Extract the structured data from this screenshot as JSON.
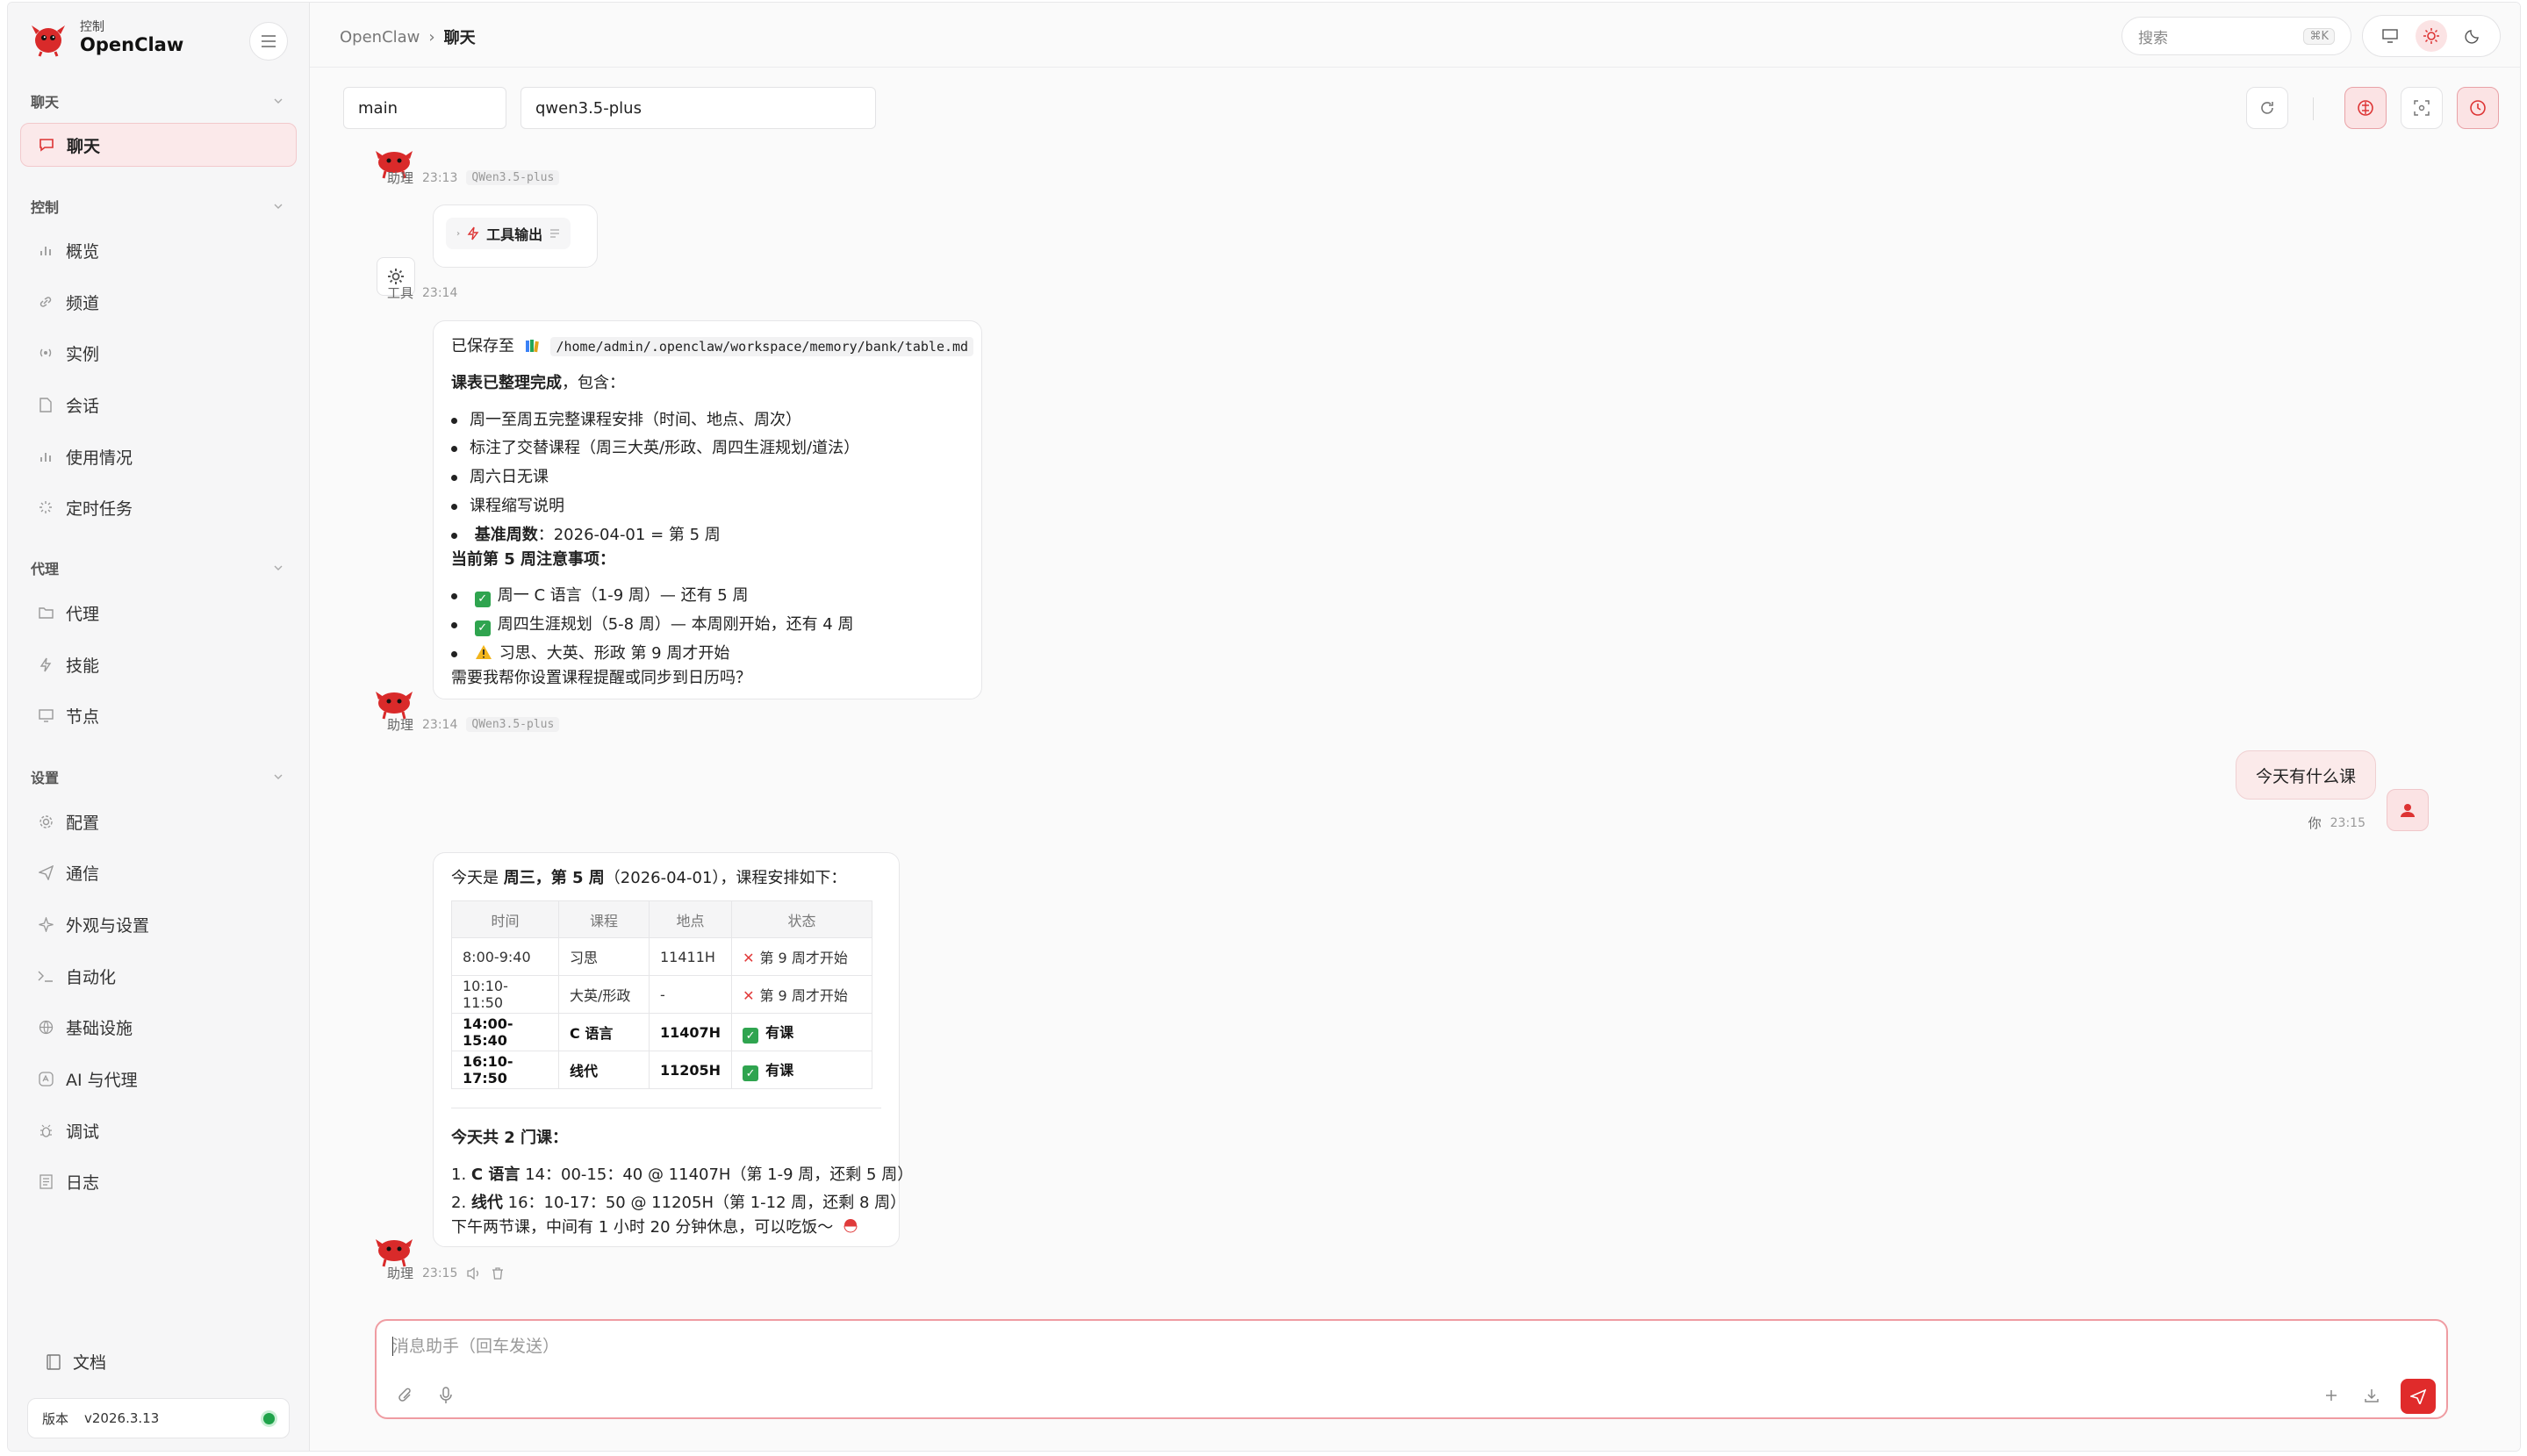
{
  "brand": {
    "sub": "控制",
    "name": "OpenClaw"
  },
  "sidebar": {
    "groups": [
      {
        "title": "聊天",
        "items": [
          {
            "label": "聊天",
            "icon": "chat-icon"
          }
        ]
      },
      {
        "title": "控制",
        "items": [
          {
            "label": "概览",
            "icon": "bar-chart-icon"
          },
          {
            "label": "频道",
            "icon": "link-icon"
          },
          {
            "label": "实例",
            "icon": "radio-icon"
          },
          {
            "label": "会话",
            "icon": "file-icon"
          },
          {
            "label": "使用情况",
            "icon": "bar-chart-icon"
          },
          {
            "label": "定时任务",
            "icon": "loader-icon"
          }
        ]
      },
      {
        "title": "代理",
        "items": [
          {
            "label": "代理",
            "icon": "folder-icon"
          },
          {
            "label": "技能",
            "icon": "bolt-icon"
          },
          {
            "label": "节点",
            "icon": "monitor-icon"
          }
        ]
      },
      {
        "title": "设置",
        "items": [
          {
            "label": "配置",
            "icon": "gear-icon"
          },
          {
            "label": "通信",
            "icon": "send-icon"
          },
          {
            "label": "外观与设置",
            "icon": "sparkle-icon"
          },
          {
            "label": "自动化",
            "icon": "terminal-icon"
          },
          {
            "label": "基础设施",
            "icon": "globe-icon"
          },
          {
            "label": "AI 与代理",
            "icon": "ai-icon"
          },
          {
            "label": "调试",
            "icon": "bug-icon"
          },
          {
            "label": "日志",
            "icon": "log-icon"
          }
        ]
      }
    ],
    "docs_label": "文档",
    "version_label": "版本",
    "version_value": "v2026.3.13"
  },
  "header": {
    "breadcrumb_root": "OpenClaw",
    "breadcrumb_sep": "›",
    "breadcrumb_current": "聊天",
    "search_placeholder": "搜索",
    "search_shortcut": "⌘K"
  },
  "toolbar": {
    "session": "main",
    "model": "qwen3.5-plus"
  },
  "messages": {
    "m1": {
      "role": "助理",
      "time": "23:13",
      "model": "QWen3.5-plus",
      "chip": "工具输出"
    },
    "m2": {
      "role": "工具",
      "time": "23:14"
    },
    "m3": {
      "saved_prefix": "已保存至",
      "saved_path": "/home/admin/.openclaw/workspace/memory/bank/table.md",
      "intro_bold": "课表已整理完成",
      "intro_rest": "，包含：",
      "bullets": [
        "周一至周五完整课程安排（时间、地点、周次）",
        "标注了交替课程（周三大英/形政、周四生涯规划/道法）",
        "周六日无课",
        "课程缩写说明"
      ],
      "base_week_label": "基准周数",
      "base_week_value": "：2026-04-01 = 第 5 周",
      "notice_title": "当前第 5 周注意事项：",
      "notices": [
        "周一 C 语言（1-9 周）— 还有 5 周",
        "周四生涯规划（5-8 周）— 本周刚开始，还有 4 周",
        "习思、大英、形政 第 9 周才开始"
      ],
      "question": "需要我帮你设置课程提醒或同步到日历吗？",
      "role": "助理",
      "time": "23:14",
      "model": "QWen3.5-plus"
    },
    "user": {
      "text": "今天有什么课",
      "role": "你",
      "time": "23:15"
    },
    "m4": {
      "line_pre": "今天是 ",
      "line_bold": "周三，第 5 周",
      "line_post": "（2026-04-01），课程安排如下：",
      "headers": [
        "时间",
        "课程",
        "地点",
        "状态"
      ],
      "rows": [
        [
          "8:00-9:40",
          "习思",
          "11411H",
          "第 9 周才开始"
        ],
        [
          "10:10-11:50",
          "大英/形政",
          "-",
          "第 9 周才开始"
        ],
        [
          "14:00-15:40",
          "C 语言",
          "11407H",
          "有课"
        ],
        [
          "16:10-17:50",
          "线代",
          "11205H",
          "有课"
        ]
      ],
      "summary_title": "今天共 2 门课：",
      "items": [
        {
          "name": "C 语言",
          "detail": " 14：00-15：40 @ 11407H（第 1-9 周，还剩 5 周）"
        },
        {
          "name": "线代",
          "detail": " 16：10-17：50 @ 11205H（第 1-12 周，还剩 8 周）"
        }
      ],
      "closing": "下午两节课，中间有 1 小时 20 分钟休息，可以吃饭～",
      "role": "助理",
      "time": "23:15"
    }
  },
  "composer": {
    "placeholder": "消息助手（回车发送）"
  },
  "colors": {
    "accent": "#e02b2b",
    "accent_soft": "#fbe3e4",
    "success": "#2fa44f"
  }
}
